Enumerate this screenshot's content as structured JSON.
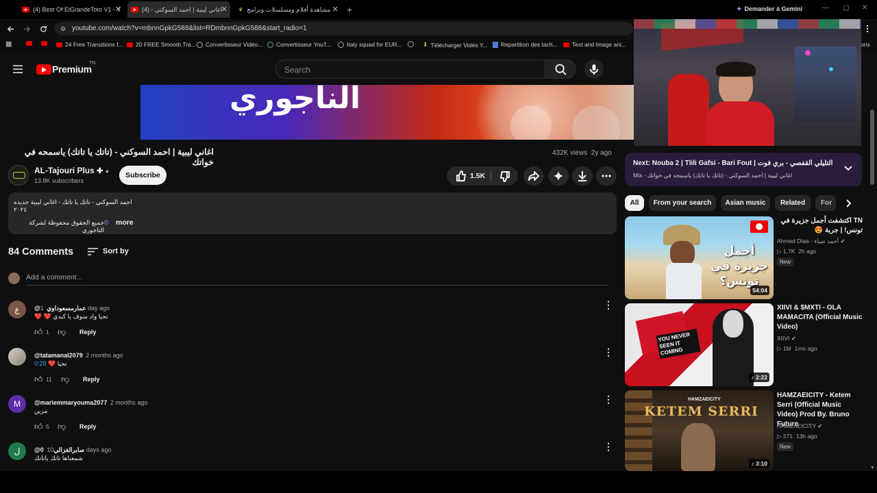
{
  "browser": {
    "tabs": [
      {
        "label": "(4) Best Of ElGrandeToto V1 - Y"
      },
      {
        "label": "اغاني ليبية | احمد السوكني - (4) "
      },
      {
        "label": "مشاهدة أفلام ومسلسلات وبرامج"
      }
    ],
    "gemini_label": "Demander à Gemini",
    "url": "youtube.com/watch?v=mbnnGpkG588&list=RDmbnnGpkG588&start_radio=1",
    "bookmarks": [
      "24 Free Transitions f...",
      "20 FREE Smooth Tra...",
      "Convertisseur Vidéo...",
      "Convertisseur YouT...",
      "Italy squad for EUR...",
      "Télécharger Vidéo Y...",
      "Repartition des tach...",
      "Text and Image ani..."
    ],
    "bookmarks_overflow": "oris"
  },
  "header": {
    "logo": "Premium",
    "country": "TN",
    "search_placeholder": "Search"
  },
  "video": {
    "banner_text": "الناجوري",
    "title": "اغاني ليبية | احمد السوكني - (تاتك يا تاتك) ياسمحه في خواتك",
    "views": "432K views",
    "age": "2y ago",
    "channel_name": "AL-Tajouri Plus",
    "subscribers": "13.8K subscribers",
    "subscribe_label": "Subscribe",
    "likes": "1.5K",
    "description_line1": "احمد السوكني - تاتك يا تاتك - اغاني ليبية جديده ٢٠٢٤",
    "description_line2": "جميع الحقوق محفوظة لشركة التاجوري",
    "more_label": "more"
  },
  "comments": {
    "count_label": "84 Comments",
    "sort_label": "Sort by",
    "add_placeholder": "Add a comment...",
    "reply_label": "Reply",
    "items": [
      {
        "initial": "ع",
        "avatar_color": "#7a5548",
        "handle": "@عمارمسعوداوي",
        "time": "1 day ago",
        "text": "تحيا واد سوف يا كبدي ❤️ ❤️",
        "likes": "1"
      },
      {
        "initial": "",
        "avatar_color": "#b0a898",
        "handle": "@tatamanal2079",
        "time": "2 months ago",
        "text": "تحيا ❤️",
        "timestamp_link": "0:29",
        "likes": "11"
      },
      {
        "initial": "M",
        "avatar_color": "#5e2ea8",
        "handle": "@mariemmaryouma2077",
        "time": "2 months ago",
        "text": "مزين",
        "likes": "5"
      },
      {
        "initial": "ل",
        "avatar_color": "#1f7a4a",
        "handle": "@صابرالغزالي0",
        "time": "10 days ago",
        "text": "شمعناها تاتك ياتاتك",
        "likes": ""
      }
    ]
  },
  "sidebar": {
    "next_label": "Next: Nouba 2 | Tlili Gafsi - Bari Fout | التليلي القفصي - بري فوت",
    "mix_label": "Mix - اغاني ليبية | احمد السوكني - (تاتك يا تاتك) ياسمحه في خواتك",
    "chips": [
      "All",
      "From your search",
      "Asian music",
      "Related",
      "For y"
    ],
    "videos": [
      {
        "title": "TN اكتشفت أجمل جزيرة في تونس! | جربة 😍",
        "channel": "Ahmed Diaa - أحمد ضياء",
        "views": "1.7K",
        "age": "2h ago",
        "badge": "New",
        "duration": "54:04",
        "thumb_text": "أجمل جزيرة في تونس؟"
      },
      {
        "title": "XIIVI & $MXTI - OLA MAMACITA (Official Music Video)",
        "channel": "XIIVI",
        "views": "1M",
        "age": "1mo ago",
        "badge": "",
        "duration": "2:22",
        "thumb_text": "YOU NEVER SEEN IT COMING"
      },
      {
        "title": "HAMZAEICITY - Ketem Serri (Official Music Video) Prod By. Bruno Future",
        "channel": "HAMZAEICITY",
        "views": "271",
        "age": "13h ago",
        "badge": "New",
        "duration": "3:10",
        "thumb_text": "KETEM SERRI",
        "thumb_sub": "HAMZAEICITY"
      }
    ]
  },
  "colors": {
    "youtube_red": "#ff0000",
    "next_box_bg": "#2a1d3b",
    "chip_active": "#f1f1f1"
  }
}
